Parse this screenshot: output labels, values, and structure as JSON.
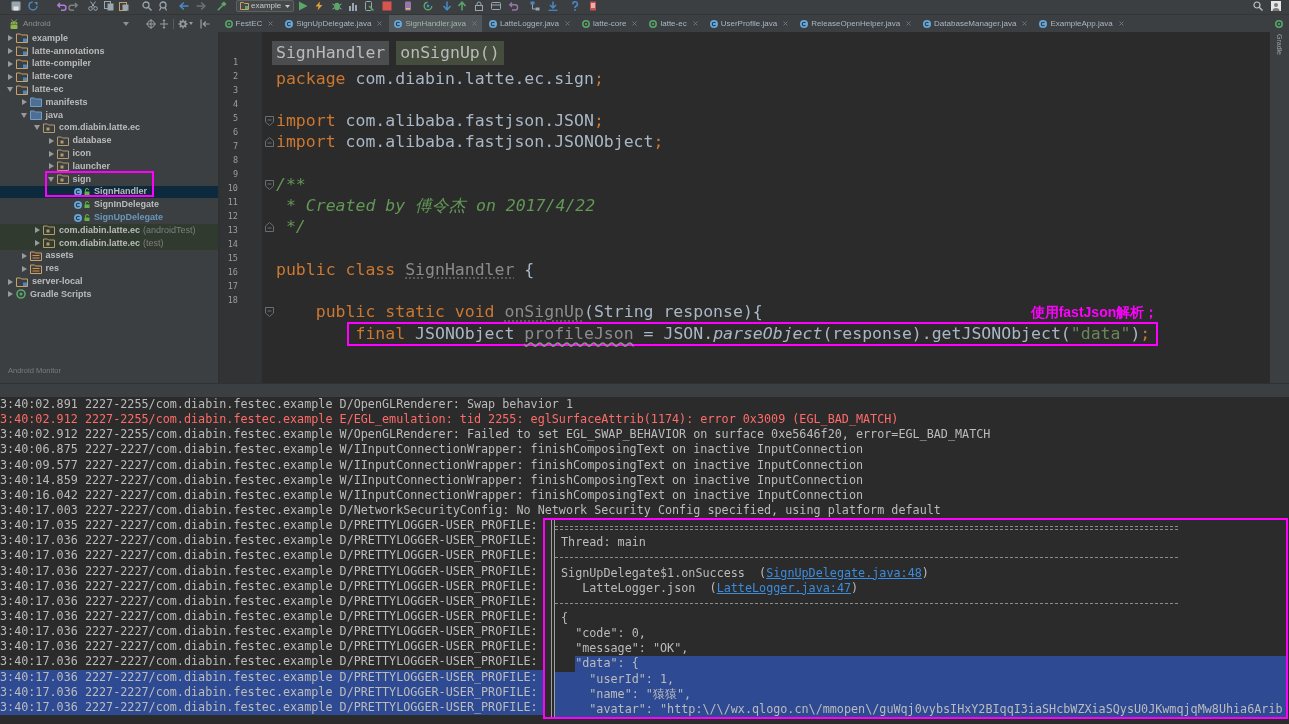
{
  "toolbar": {
    "run_config": "example"
  },
  "view_selector": {
    "label": "Android"
  },
  "tabs": [
    {
      "label": "FestEC",
      "kind": "module",
      "selected": false
    },
    {
      "label": "SignUpDelegate.java",
      "kind": "class",
      "selected": false
    },
    {
      "label": "SignHandler.java",
      "kind": "class",
      "selected": true
    },
    {
      "label": "LatteLogger.java",
      "kind": "class",
      "selected": false
    },
    {
      "label": "latte-core",
      "kind": "module",
      "selected": false
    },
    {
      "label": "latte-ec",
      "kind": "module",
      "selected": false
    },
    {
      "label": "UserProfile.java",
      "kind": "class",
      "selected": false
    },
    {
      "label": "ReleaseOpenHelper.java",
      "kind": "class",
      "selected": false
    },
    {
      "label": "DatabaseManager.java",
      "kind": "class",
      "selected": false
    },
    {
      "label": "ExampleApp.java",
      "kind": "class",
      "selected": false
    }
  ],
  "project_tree": {
    "items": [
      {
        "label": "example",
        "kind": "module",
        "expanded": false,
        "selected": false
      },
      {
        "label": "latte-annotations",
        "kind": "module",
        "expanded": false,
        "selected": false
      },
      {
        "label": "latte-compiler",
        "kind": "module",
        "expanded": false,
        "selected": false
      },
      {
        "label": "latte-core",
        "kind": "module",
        "expanded": false,
        "selected": false
      },
      {
        "label": "latte-ec",
        "kind": "module",
        "expanded": true,
        "selected": false,
        "children": [
          {
            "label": "manifests",
            "kind": "source-folder",
            "expanded": false,
            "selected": false
          },
          {
            "label": "java",
            "kind": "source-folder",
            "expanded": true,
            "selected": false,
            "children": [
              {
                "label": "com.diabin.latte.ec",
                "kind": "package",
                "expanded": true,
                "selected": false,
                "children": [
                  {
                    "label": "database",
                    "kind": "package",
                    "expanded": false,
                    "selected": false,
                    "framed": false
                  },
                  {
                    "label": "icon",
                    "kind": "package",
                    "expanded": false,
                    "selected": false,
                    "framed": false
                  },
                  {
                    "label": "launcher",
                    "kind": "package",
                    "expanded": false,
                    "selected": false,
                    "framed": false
                  },
                  {
                    "label": "sign",
                    "kind": "package",
                    "expanded": true,
                    "selected": false,
                    "framed": true,
                    "children": [
                      {
                        "label": "SignHandler",
                        "kind": "class",
                        "selected": true,
                        "modified": false
                      },
                      {
                        "label": "SignInDelegate",
                        "kind": "class",
                        "selected": false,
                        "modified": false
                      },
                      {
                        "label": "SignUpDelegate",
                        "kind": "class",
                        "selected": false,
                        "modified": true
                      }
                    ]
                  }
                ]
              },
              {
                "label": "com.diabin.latte.ec",
                "suffix": "(androidTest)",
                "kind": "test-package",
                "expanded": false,
                "selected": false
              },
              {
                "label": "com.diabin.latte.ec",
                "suffix": "(test)",
                "kind": "test-package",
                "expanded": false,
                "selected": false
              }
            ]
          },
          {
            "label": "assets",
            "kind": "resource-folder",
            "expanded": false,
            "selected": false
          },
          {
            "label": "res",
            "kind": "resource-folder",
            "expanded": false,
            "selected": false
          }
        ]
      },
      {
        "label": "server-local",
        "kind": "module",
        "expanded": false,
        "selected": false
      },
      {
        "label": "Gradle Scripts",
        "kind": "gradle",
        "expanded": false,
        "selected": false
      }
    ],
    "footer": "Android Monitor"
  },
  "editor": {
    "breadcrumbs": [
      {
        "label": "SignHandler",
        "kind": "class"
      },
      {
        "label": "onSignUp()",
        "kind": "method"
      }
    ],
    "line_numbers": [
      "1",
      "2",
      "3",
      "4",
      "5",
      "6",
      "7",
      "8",
      "9",
      "10",
      "11",
      "12",
      "13",
      "14",
      "15",
      "16",
      "17",
      "18"
    ],
    "lines": [
      {
        "tokens": [
          {
            "text": "package",
            "kind": "keyword"
          },
          {
            "text": " com.diabin.latte.ec.sign",
            "kind": "plain"
          },
          {
            "text": ";",
            "kind": "keyword"
          }
        ],
        "framed": false
      },
      {
        "framed": false
      },
      {
        "tokens": [
          {
            "text": "import",
            "kind": "keyword"
          },
          {
            "text": " com.alibaba.fastjson.JSON",
            "kind": "plain"
          },
          {
            "text": ";",
            "kind": "keyword"
          }
        ],
        "fold_marker": {
          "kind": "start"
        },
        "framed": false
      },
      {
        "tokens": [
          {
            "text": "import",
            "kind": "keyword"
          },
          {
            "text": " com.alibaba.fastjson.JSONObject",
            "kind": "plain"
          },
          {
            "text": ";",
            "kind": "keyword"
          }
        ],
        "fold_marker": {
          "kind": "end"
        },
        "framed": false
      },
      {
        "framed": false
      },
      {
        "tokens": [
          {
            "text": "/**",
            "kind": "doc"
          }
        ],
        "fold_marker": {
          "kind": "start"
        },
        "framed": false
      },
      {
        "tokens": [
          {
            "text": " * Created by 傅令杰 on 2017/4/22",
            "kind": "doc"
          }
        ],
        "framed": false
      },
      {
        "tokens": [
          {
            "text": " */",
            "kind": "doc"
          }
        ],
        "fold_marker": {
          "kind": "end"
        },
        "framed": false
      },
      {
        "framed": false
      },
      {
        "tokens": [
          {
            "text": "public class ",
            "kind": "keyword"
          },
          {
            "text": "SignHandler",
            "kind": "unused"
          },
          {
            "text": " {",
            "kind": "plain"
          }
        ],
        "framed": false
      },
      {
        "framed": false
      },
      {
        "tokens": [
          {
            "text": "    public static void ",
            "kind": "keyword"
          },
          {
            "text": "onSignUp",
            "kind": "unused"
          },
          {
            "text": "(String response){",
            "kind": "plain"
          }
        ],
        "fold_marker": {
          "kind": "start"
        },
        "framed": false
      },
      {
        "tokens": [
          {
            "text": "        final",
            "kind": "keyword"
          },
          {
            "text": " JSONObject ",
            "kind": "plain"
          },
          {
            "text": "profileJson",
            "kind": "unused-variable"
          },
          {
            "text": " = JSON.",
            "kind": "plain"
          },
          {
            "text": "parseObject",
            "kind": "static-call"
          },
          {
            "text": "(response).getJSONObject(",
            "kind": "plain"
          },
          {
            "text": "\"data\"",
            "kind": "string"
          },
          {
            "text": ")",
            "kind": "plain"
          },
          {
            "text": ";",
            "kind": "keyword"
          }
        ],
        "framed": true,
        "note": "使用fastJson解析；"
      }
    ]
  },
  "side_strip": {
    "label": "Gradle"
  },
  "log": {
    "lines": [
      {
        "text": "3:40:02.891 2227-2255/com.diabin.festec.example D/OpenGLRenderer: Swap behavior 1",
        "error": false,
        "selected": false
      },
      {
        "text": "3:40:02.912 2227-2255/com.diabin.festec.example E/EGL_emulation: tid 2255: eglSurfaceAttrib(1174): error 0x3009 (EGL_BAD_MATCH)",
        "error": true,
        "selected": false
      },
      {
        "text": "3:40:02.912 2227-2255/com.diabin.festec.example W/OpenGLRenderer: Failed to set EGL_SWAP_BEHAVIOR on surface 0xe5646f20, error=EGL_BAD_MATCH",
        "error": false,
        "selected": false
      },
      {
        "text": "3:40:06.875 2227-2227/com.diabin.festec.example W/IInputConnectionWrapper: finishComposingText on inactive InputConnection",
        "error": false,
        "selected": false
      },
      {
        "text": "3:40:09.577 2227-2227/com.diabin.festec.example W/IInputConnectionWrapper: finishComposingText on inactive InputConnection",
        "error": false,
        "selected": false
      },
      {
        "text": "3:40:14.859 2227-2227/com.diabin.festec.example W/IInputConnectionWrapper: finishComposingText on inactive InputConnection",
        "error": false,
        "selected": false
      },
      {
        "text": "3:40:16.042 2227-2227/com.diabin.festec.example W/IInputConnectionWrapper: finishComposingText on inactive InputConnection",
        "error": false,
        "selected": false
      },
      {
        "text": "3:40:17.003 2227-2227/com.diabin.festec.example D/NetworkSecurityConfig: No Network Security Config specified, using platform default",
        "error": false,
        "selected": false
      },
      {
        "text": "3:40:17.035 2227-2227/com.diabin.festec.example D/PRETTYLOGGER-USER_PROFILE:",
        "error": false,
        "selected": false
      },
      {
        "text": "3:40:17.036 2227-2227/com.diabin.festec.example D/PRETTYLOGGER-USER_PROFILE:",
        "error": false,
        "selected": false
      },
      {
        "text": "3:40:17.036 2227-2227/com.diabin.festec.example D/PRETTYLOGGER-USER_PROFILE:",
        "error": false,
        "selected": false
      },
      {
        "text": "3:40:17.036 2227-2227/com.diabin.festec.example D/PRETTYLOGGER-USER_PROFILE:",
        "error": false,
        "selected": false
      },
      {
        "text": "3:40:17.036 2227-2227/com.diabin.festec.example D/PRETTYLOGGER-USER_PROFILE:",
        "error": false,
        "selected": false
      },
      {
        "text": "3:40:17.036 2227-2227/com.diabin.festec.example D/PRETTYLOGGER-USER_PROFILE:",
        "error": false,
        "selected": false
      },
      {
        "text": "3:40:17.036 2227-2227/com.diabin.festec.example D/PRETTYLOGGER-USER_PROFILE:",
        "error": false,
        "selected": false
      },
      {
        "text": "3:40:17.036 2227-2227/com.diabin.festec.example D/PRETTYLOGGER-USER_PROFILE:",
        "error": false,
        "selected": false
      },
      {
        "text": "3:40:17.036 2227-2227/com.diabin.festec.example D/PRETTYLOGGER-USER_PROFILE:",
        "error": false,
        "selected": false
      },
      {
        "text": "3:40:17.036 2227-2227/com.diabin.festec.example D/PRETTYLOGGER-USER_PROFILE:",
        "error": false,
        "selected": false
      },
      {
        "text": "3:40:17.036 2227-2227/com.diabin.festec.example D/PRETTYLOGGER-USER_PROFILE:",
        "error": false,
        "selected": true
      },
      {
        "text": "3:40:17.036 2227-2227/com.diabin.festec.example D/PRETTYLOGGER-USER_PROFILE:",
        "error": false,
        "selected": true
      },
      {
        "text": "3:40:17.036 2227-2227/com.diabin.festec.example D/PRETTYLOGGER-USER_PROFILE:",
        "error": false,
        "selected": true
      }
    ],
    "message_box": {
      "framed": true,
      "rows": [
        {
          "kind": "border",
          "selected": false
        },
        {
          "kind": "text",
          "text": "Thread: main",
          "selected": false
        },
        {
          "kind": "separator",
          "selected": false
        },
        {
          "kind": "trace",
          "text": "SignUpDelegate$1.onSuccess  (",
          "link": "SignUpDelegate.java:48",
          "tail": ")",
          "selected": false
        },
        {
          "kind": "trace",
          "text": "   LatteLogger.json  (",
          "link": "LatteLogger.java:47",
          "tail": ")",
          "selected": false
        },
        {
          "kind": "separator",
          "selected": false
        },
        {
          "kind": "text",
          "text": "{",
          "selected": false
        },
        {
          "kind": "text",
          "text": "  \"code\": 0,",
          "selected": false
        },
        {
          "kind": "text",
          "text": "  \"message\": \"OK\",",
          "selected": false
        },
        {
          "kind": "text",
          "text": "  \"data\": {",
          "selected": true
        },
        {
          "kind": "text",
          "text": "    \"userId\": 1,",
          "selected": true
        },
        {
          "kind": "text",
          "text": "    \"name\": \"猿猿\",",
          "selected": true
        },
        {
          "kind": "text",
          "text": "    \"avatar\": \"http:\\/\\/wx.qlogo.cn\\/mmopen\\/guWqj0vybsIHxY2BIqqI3iaSHcbWZXiaSQysU0JKwmqjqMw8Uhia6Arib",
          "selected": true
        }
      ]
    }
  }
}
